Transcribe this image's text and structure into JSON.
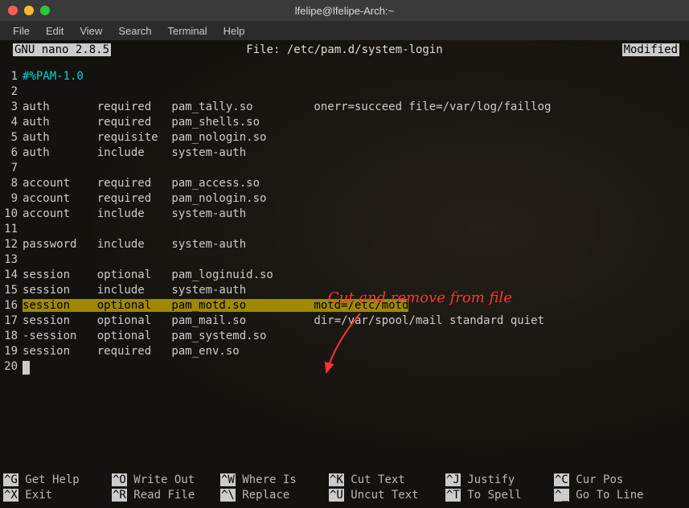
{
  "window": {
    "title": "lfelipe@lfelipe-Arch:~"
  },
  "menu": {
    "file": "File",
    "edit": "Edit",
    "view": "View",
    "search": "Search",
    "terminal": "Terminal",
    "help": "Help"
  },
  "nano": {
    "version": "  GNU nano 2.8.5  ",
    "file_prefix": "File: ",
    "file_path": "/etc/pam.d/system-login",
    "modified": "Modified "
  },
  "lines": {
    "l1": "#%PAM-1.0",
    "l2": "",
    "l3": "auth       required   pam_tally.so         onerr=succeed file=/var/log/faillog",
    "l4": "auth       required   pam_shells.so",
    "l5": "auth       requisite  pam_nologin.so",
    "l6": "auth       include    system-auth",
    "l7": "",
    "l8": "account    required   pam_access.so",
    "l9": "account    required   pam_nologin.so",
    "l10": "account    include    system-auth",
    "l11": "",
    "l12": "password   include    system-auth",
    "l13": "",
    "l14": "session    optional   pam_loginuid.so",
    "l15": "session    include    system-auth",
    "l16_a": "session    optional   pam_motd.so          motd=/etc/motd",
    "l17": "session    optional   pam_mail.so          dir=/var/spool/mail standard quiet",
    "l18": "-session   optional   pam_systemd.so",
    "l19": "session    required   pam_env.so",
    "l20": ""
  },
  "annotation": {
    "text": "Cut and remove from file"
  },
  "footer": {
    "k1": "^G",
    "l1": "Get Help",
    "k2": "^O",
    "l2": "Write Out",
    "k3": "^W",
    "l3": "Where Is",
    "k4": "^K",
    "l4": "Cut Text",
    "k5": "^J",
    "l5": "Justify",
    "k6": "^C",
    "l6": "Cur Pos",
    "k7": "^X",
    "l7": "Exit",
    "k8": "^R",
    "l8": "Read File",
    "k9": "^\\",
    "l9": "Replace",
    "k10": "^U",
    "l10": "Uncut Text",
    "k11": "^T",
    "l11": "To Spell",
    "k12": "^_",
    "l12": "Go To Line"
  }
}
